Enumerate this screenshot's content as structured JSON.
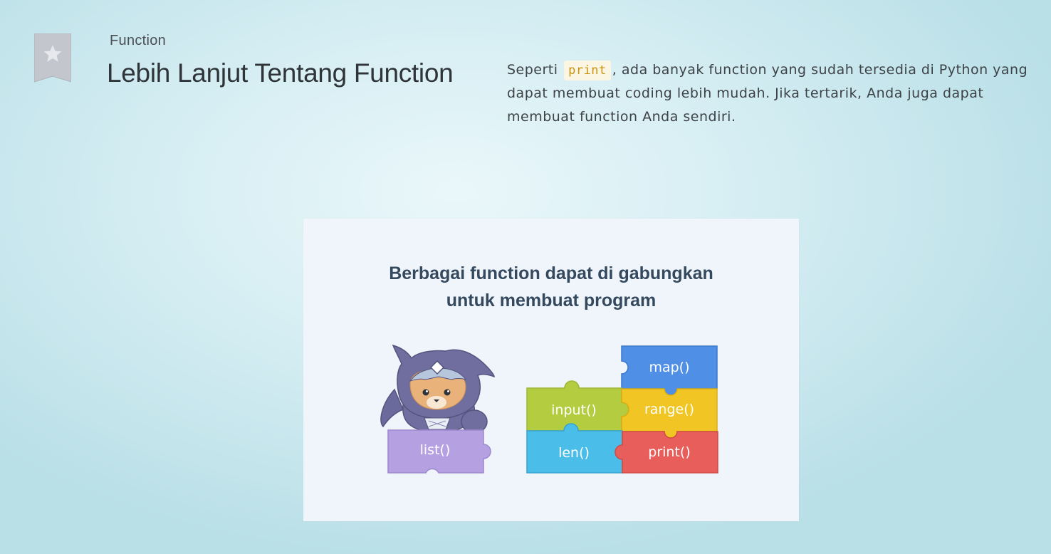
{
  "header": {
    "bookmark_icon": "star-icon",
    "category": "Function",
    "title": "Lebih Lanjut Tentang Function"
  },
  "description": {
    "text_before": "Seperti",
    "code": "print",
    "text_after": ", ada banyak function yang sudah tersedia di Python yang dapat membuat coding lebih mudah. Jika tertarik, Anda juga dapat membuat function Anda sendiri."
  },
  "illustration": {
    "title_line1": "Berbagai function dapat di gabungkan",
    "title_line2": "untuk membuat program",
    "pieces": {
      "map": "map()",
      "input": "input()",
      "range": "range()",
      "len": "len()",
      "print": "print()",
      "list": "list()"
    },
    "colors": {
      "map": "#4f8fe6",
      "input": "#b4cd40",
      "range": "#f1c523",
      "len": "#4bbde9",
      "print": "#e85e5a",
      "list": "#b5a1e1",
      "character": "#6f6e9f"
    }
  }
}
